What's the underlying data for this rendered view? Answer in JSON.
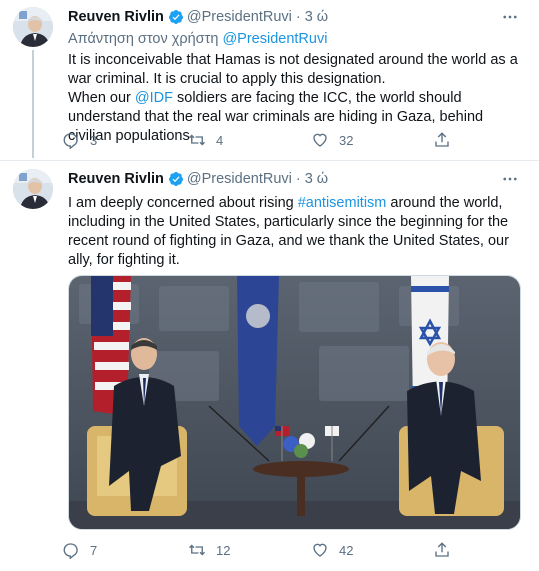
{
  "tweet1": {
    "name": "Reuven Rivlin",
    "handle": "@PresidentRuvi",
    "dot": "·",
    "time": "3 ώ",
    "reply_prefix": "Απάντηση στον χρήστη",
    "reply_handle": "@PresidentRuvi",
    "line1": "It is inconceivable that Hamas is not designated around the world as a war criminal. It is crucial to apply this designation.",
    "line2_pre": "When our ",
    "line2_mention": "@IDF",
    "line2_post": " soldiers are facing the ICC, the world should understand that the real war criminals are hiding in Gaza, behind civilian populations.",
    "replies": "3",
    "retweets": "4",
    "likes": "32"
  },
  "tweet2": {
    "name": "Reuven Rivlin",
    "handle": "@PresidentRuvi",
    "dot": "·",
    "time": "3 ώ",
    "text_pre": "I am deeply concerned about rising ",
    "hashtag": "#antisemitism",
    "text_post": " around the world, including in the United States, particularly since the beginning for the recent round of fighting in Gaza, and we thank the United States, our ally, for fighting it.",
    "replies": "7",
    "retweets": "12",
    "likes": "42"
  },
  "colors": {
    "link": "#1b95e0",
    "secondary": "#5b7083",
    "verified": "#1da1f2",
    "divider": "#e6ecf0"
  },
  "icons": [
    "verified-badge-icon",
    "more-icon",
    "reply-icon",
    "retweet-icon",
    "like-icon",
    "share-icon"
  ]
}
